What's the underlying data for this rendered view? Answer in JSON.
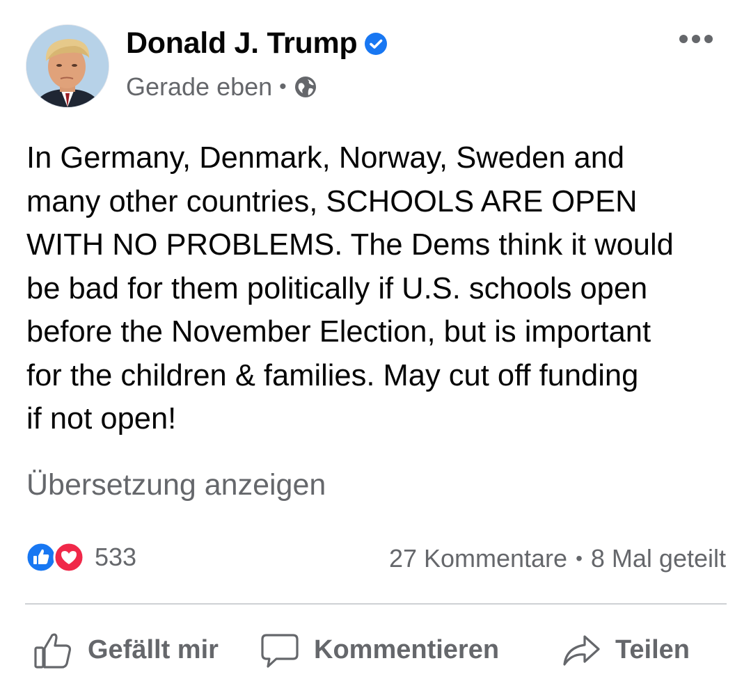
{
  "post": {
    "author": "Donald J. Trump",
    "verified": true,
    "time": "Gerade eben",
    "separator": "•",
    "audience_icon": "globe-icon",
    "more_icon": "more-options-icon",
    "text": "In Germany, Denmark, Norway,  Sweden and\nmany other countries, SCHOOLS ARE OPEN\nWITH NO PROBLEMS. The Dems think it would\nbe bad for them politically if U.S. schools open\nbefore the November Election, but is important\nfor the children & families. May cut off funding\nif not open!",
    "translate_label": "Übersetzung anzeigen"
  },
  "reactions": {
    "icons": [
      "like-reaction-icon",
      "love-reaction-icon"
    ],
    "count": "533",
    "comments": "27 Kommentare",
    "dot": "•",
    "shares": "8 Mal geteilt"
  },
  "actions": {
    "like": "Gefällt mir",
    "comment": "Kommentieren",
    "share": "Teilen"
  },
  "colors": {
    "text": "#050505",
    "secondary": "#65676b",
    "like_blue": "#1877f2",
    "love_red": "#f02849",
    "divider": "#ced0d4"
  }
}
